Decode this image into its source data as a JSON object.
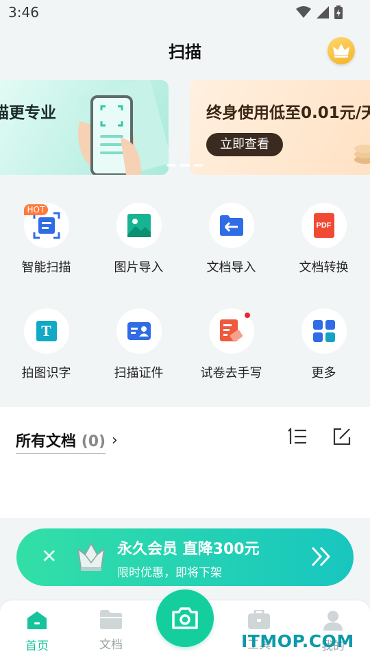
{
  "status": {
    "time": "3:46"
  },
  "header": {
    "title": "扫描"
  },
  "banners": [
    {
      "text": "描更专业"
    },
    {
      "text": "终身使用低至0.01元/天",
      "button": "立即查看"
    }
  ],
  "tools": [
    {
      "label": "智能扫描",
      "icon": "smart-scan-icon",
      "badge": "HOT"
    },
    {
      "label": "图片导入",
      "icon": "image-import-icon"
    },
    {
      "label": "文档导入",
      "icon": "document-import-icon"
    },
    {
      "label": "文档转换",
      "icon": "pdf-convert-icon",
      "icon_text": "PDF"
    },
    {
      "label": "拍图识字",
      "icon": "text-recognition-icon",
      "icon_text": "T"
    },
    {
      "label": "扫描证件",
      "icon": "id-card-icon"
    },
    {
      "label": "试卷去手写",
      "icon": "exam-erase-icon"
    },
    {
      "label": "更多",
      "icon": "more-grid-icon"
    }
  ],
  "docs": {
    "title": "所有文档",
    "count": "(0)"
  },
  "promo": {
    "title": "永久会员 直降300元",
    "subtitle": "限时优惠，即将下架"
  },
  "nav": [
    {
      "label": "首页",
      "icon": "home-icon",
      "active": true
    },
    {
      "label": "文档",
      "icon": "folder-icon"
    },
    {
      "label": "工具",
      "icon": "toolbox-icon"
    },
    {
      "label": "我的",
      "icon": "profile-icon"
    }
  ],
  "watermark": "ITMOP.COM",
  "colors": {
    "accent": "#17c39b",
    "fab": "#14cf9d",
    "tool_blue": "#2f6ce5",
    "pdf_red": "#f04a35"
  }
}
